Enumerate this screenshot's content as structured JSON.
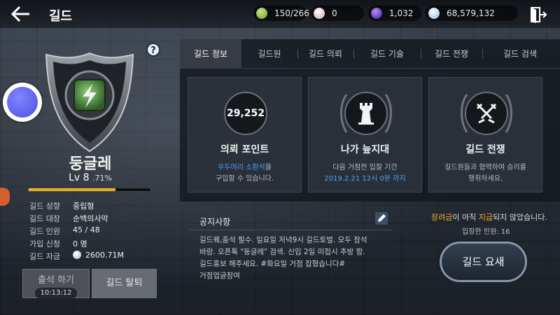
{
  "header": {
    "title": "길드",
    "currencies": [
      {
        "icon": "stamina-icon",
        "value": "150/266",
        "color": "#8bc34a"
      },
      {
        "icon": "pearl-icon",
        "value": "0",
        "color": "#e8d8d8"
      },
      {
        "icon": "amethyst-icon",
        "value": "1,032",
        "color": "#7b3fe4"
      },
      {
        "icon": "silver-coin-icon",
        "value": "68,579,132",
        "color": "#b9d6f2"
      }
    ]
  },
  "guild": {
    "name": "둥글레",
    "level_label": "Lv 8",
    "level_percent": ".71%",
    "xp_fraction": 0.71,
    "info": [
      {
        "label": "길드 성향",
        "value": "중립형"
      },
      {
        "label": "길드 대장",
        "value": "순백의사막"
      },
      {
        "label": "길드 인원",
        "value": "45 / 48"
      },
      {
        "label": "가입 신청",
        "value": "0 명"
      },
      {
        "label": "길드 자금",
        "value": "2600.71M"
      }
    ]
  },
  "buttons": {
    "attend": "출석 하기",
    "attend_timer": "10:13:12",
    "leave": "길드 탈퇴",
    "dungeon": "길드 요새"
  },
  "tabs": [
    "길드 정보",
    "길드원",
    "길드 의뢰",
    "길드 기술",
    "길드 전쟁",
    "길드 검색"
  ],
  "cards": [
    {
      "circle_value": "29,252",
      "title": "의뢰 포인트",
      "desc_blue": "우두머리 소환석",
      "desc_rest": "을",
      "desc_line2": "구입할 수 있습니다."
    },
    {
      "title": "나가 늪지대",
      "desc_line1": "다음 거점전 입찰 기간",
      "desc_blue2": "2019.2.21 12시 0분 까지"
    },
    {
      "title": "길드 전쟁",
      "desc_line1": "길드원들과 협력하여 승리를",
      "desc_line2": "쟁취하세요."
    }
  ],
  "notice": {
    "title": "공지사항",
    "body": "길드퀘,출석 필수. 일요일 저녁9시 길드토벌. 모두 참석\n바람. 오픈톡 \"둥글레\" 검색. 신입 2일 미접시 추방 함.\n길드홍보 해주세요.  #화요일 거점 잡혔습니다#\n거점업글참여"
  },
  "reward": {
    "word1": "장려금",
    "mid": "이 아직 ",
    "word2": "지급",
    "end": "되지 않았습니다.",
    "entered": "입장한 인원: 16"
  }
}
